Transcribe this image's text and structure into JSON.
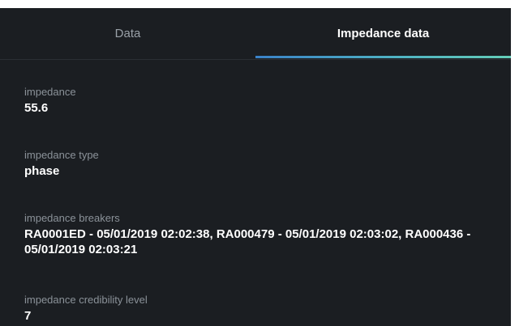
{
  "tabs": [
    {
      "label": "Data",
      "active": false
    },
    {
      "label": "Impedance data",
      "active": true
    }
  ],
  "fields": [
    {
      "label": "impedance",
      "value": "55.6"
    },
    {
      "label": "impedance type",
      "value": "phase"
    },
    {
      "label": "impedance breakers",
      "value": "RA0001ED - 05/01/2019 02:02:38, RA000479 - 05/01/2019 02:03:02, RA000436 - 05/01/2019 02:03:21"
    },
    {
      "label": "impedance credibility level",
      "value": "7"
    }
  ],
  "colors": {
    "panel_background": "#1b1e22",
    "label": "#8b9299",
    "value": "#ffffff",
    "tab_indicator": "#4fb3c4"
  }
}
